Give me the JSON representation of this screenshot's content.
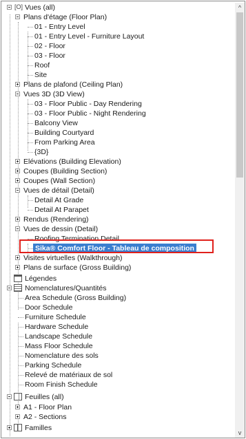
{
  "tree": {
    "root": "Vues (all)",
    "floor_plans": {
      "label": "Plans d'étage (Floor Plan)",
      "items": [
        "01 - Entry Level",
        "01 - Entry Level - Furniture Layout",
        "02 - Floor",
        "03 - Floor",
        "Roof",
        "Site"
      ]
    },
    "ceiling_plans": "Plans de plafond (Ceiling Plan)",
    "views_3d": {
      "label": "Vues 3D (3D View)",
      "items": [
        "03 - Floor Public - Day Rendering",
        "03 - Floor Public - Night Rendering",
        "Balcony View",
        "Building Courtyard",
        "From Parking Area",
        "{3D}"
      ]
    },
    "elevations": "Elévations (Building Elevation)",
    "sections_building": "Coupes (Building Section)",
    "sections_wall": "Coupes (Wall Section)",
    "detail_views": {
      "label": "Vues de détail (Detail)",
      "items": [
        "Detail At Grade",
        "Detail At Parapet"
      ]
    },
    "renderings": "Rendus (Rendering)",
    "drafting_views": {
      "label": "Vues de dessin (Detail)",
      "items": [
        "Roofing Termination Detail",
        "Sika® Comfort Floor - Tableau de composition"
      ]
    },
    "walkthroughs": "Visites virtuelles (Walkthrough)",
    "area_plans": "Plans de surface (Gross Building)",
    "legends": "Légendes",
    "schedules": {
      "label": "Nomenclatures/Quantités",
      "items": [
        "Area Schedule (Gross Building)",
        "Door Schedule",
        "Furniture Schedule",
        "Hardware Schedule",
        "Landscape Schedule",
        "Mass Floor Schedule",
        "Nomenclature des sols",
        "Parking Schedule",
        "Relevé de matériaux de sol",
        "Room Finish Schedule"
      ]
    },
    "sheets": {
      "label": "Feuilles (all)",
      "items": [
        "A1 - Floor Plan",
        "A2 - Sections"
      ]
    },
    "families": "Familles"
  },
  "colors": {
    "selection": "#3a7ecf",
    "highlight_box": "#e0201b"
  },
  "scrollbar": {
    "up_icon": "chevron-up-icon",
    "down_icon": "chevron-down-icon",
    "up": "^",
    "down": "v"
  }
}
